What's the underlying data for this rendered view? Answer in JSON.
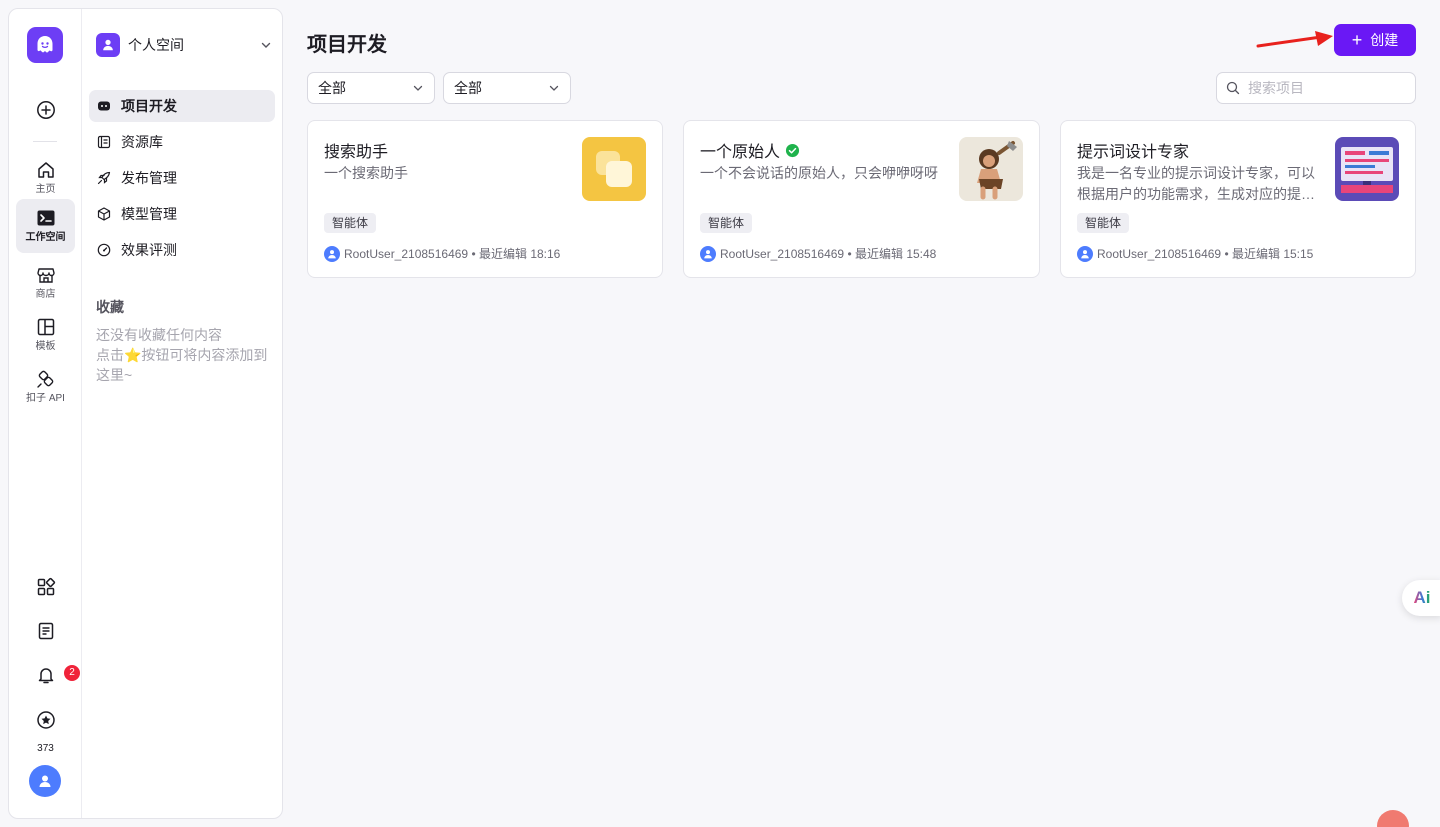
{
  "rail": {
    "items": [
      {
        "label": "",
        "icon": "plus-circle-icon"
      },
      {
        "label": "主页",
        "icon": "home-icon"
      },
      {
        "label": "工作空间",
        "icon": "terminal-icon"
      },
      {
        "label": "商店",
        "icon": "store-icon"
      },
      {
        "label": "模板",
        "icon": "template-icon"
      },
      {
        "label": "扣子 API",
        "icon": "api-icon"
      }
    ],
    "bottom": {
      "notification_count": "2",
      "points": "373"
    }
  },
  "panel": {
    "space_name": "个人空间",
    "nav": [
      {
        "label": "项目开发",
        "active": true
      },
      {
        "label": "资源库"
      },
      {
        "label": "发布管理"
      },
      {
        "label": "模型管理"
      },
      {
        "label": "效果评测"
      }
    ],
    "favorites": {
      "title": "收藏",
      "empty_line1": "还没有收藏任何内容",
      "empty_line2": "点击⭐按钮可将内容添加到这里~"
    }
  },
  "main": {
    "title": "项目开发",
    "create_label": "创建",
    "filter1": "全部",
    "filter2": "全部",
    "search_placeholder": "搜索项目",
    "cards": [
      {
        "title": "搜索助手",
        "desc": "一个搜索助手",
        "tag": "智能体",
        "author": "RootUser_2108516469",
        "edited": "最近编辑 18:16"
      },
      {
        "title": "一个原始人",
        "desc": "一个不会说话的原始人，只会咿咿呀呀",
        "tag": "智能体",
        "author": "RootUser_2108516469",
        "edited": "最近编辑 15:48"
      },
      {
        "title": "提示词设计专家",
        "desc": "我是一名专业的提示词设计专家，可以根据用户的功能需求，生成对应的提…",
        "tag": "智能体",
        "author": "RootUser_2108516469",
        "edited": "最近编辑 15:15"
      }
    ]
  },
  "float": {
    "ai_label": "Ai"
  },
  "colors": {
    "accent": "#6a18f5",
    "brand": "#6d3ef5",
    "badge": "#f0233a",
    "avatar": "#4d7cfe"
  }
}
